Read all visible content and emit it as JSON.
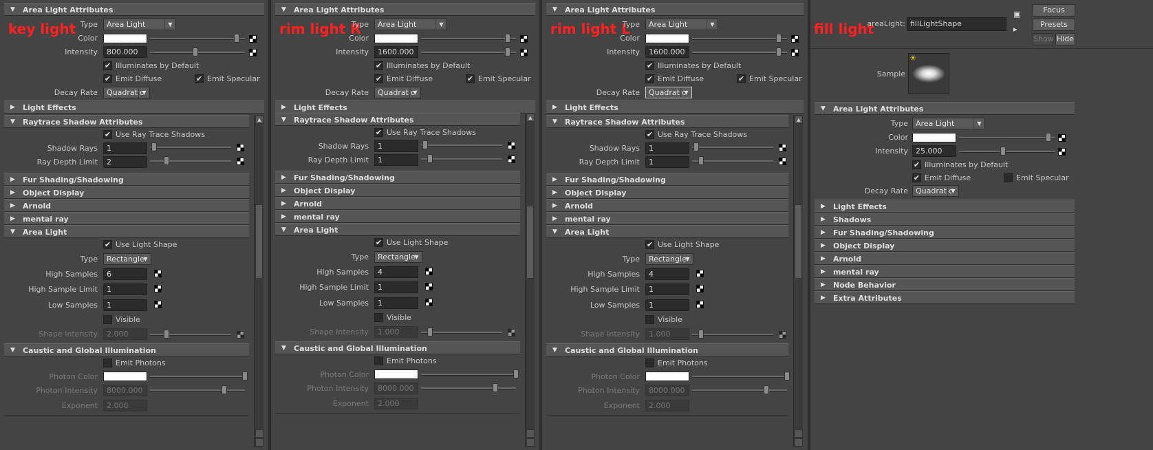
{
  "panes": [
    {
      "label": "key light",
      "type": "Area Light",
      "intensity": "800.000",
      "decay": "Quadratic",
      "shadow_rays": "1",
      "ray_depth": "2",
      "area_type": "Rectangle",
      "high_samples": "6",
      "high_sample_limit": "1",
      "low_samples": "1",
      "shape_intensity": "2.000",
      "photon_intensity": "8000.000",
      "exponent": "2.000"
    },
    {
      "label": "rim light R",
      "type": "Area Light",
      "intensity": "1600.000",
      "decay": "Quadratic",
      "shadow_rays": "1",
      "ray_depth": "1",
      "area_type": "Rectangle",
      "high_samples": "4",
      "high_sample_limit": "1",
      "low_samples": "1",
      "shape_intensity": "1.000",
      "photon_intensity": "8000.000",
      "exponent": "2.000"
    },
    {
      "label": "rim light L",
      "type": "Area Light",
      "intensity": "1600.000",
      "decay": "Quadratic",
      "shadow_rays": "1",
      "ray_depth": "1",
      "area_type": "Rectangle",
      "high_samples": "4",
      "high_sample_limit": "1",
      "low_samples": "1",
      "shape_intensity": "1.000",
      "photon_intensity": "8000.000",
      "exponent": "2.000"
    }
  ],
  "labels": {
    "area_light_attributes": "Area Light Attributes",
    "type": "Type",
    "color": "Color",
    "intensity": "Intensity",
    "illuminates": "Illuminates by Default",
    "emit_diffuse": "Emit Diffuse",
    "emit_specular": "Emit Specular",
    "decay_rate": "Decay Rate",
    "light_effects": "Light Effects",
    "raytrace": "Raytrace Shadow Attributes",
    "use_rt": "Use Ray Trace Shadows",
    "shadow_rays": "Shadow Rays",
    "ray_depth": "Ray Depth Limit",
    "fur": "Fur Shading/Shadowing",
    "object_display": "Object Display",
    "arnold": "Arnold",
    "mental_ray": "mental ray",
    "area_light": "Area Light",
    "use_light_shape": "Use Light Shape",
    "high_samples": "High Samples",
    "high_sample_limit": "High Sample Limit",
    "low_samples": "Low Samples",
    "visible": "Visible",
    "shape_intensity": "Shape Intensity",
    "caustic": "Caustic and Global Illumination",
    "emit_photons": "Emit Photons",
    "photon_color": "Photon Color",
    "photon_intensity": "Photon Intensity",
    "exponent": "Exponent",
    "shadows": "Shadows",
    "node_behavior": "Node Behavior",
    "extra_attributes": "Extra Attributes"
  },
  "fill": {
    "label": "fill light",
    "node_label": "areaLight:",
    "node_name": "fillLightShape",
    "sample_label": "Sample",
    "type": "Area Light",
    "intensity": "25.000",
    "decay": "Quadratic",
    "buttons": {
      "focus": "Focus",
      "presets": "Presets",
      "show": "Show",
      "hide": "Hide"
    },
    "icons": [
      "load-attributes-icon",
      "copy-tab-icon"
    ]
  },
  "colors": {
    "label_red": "#ff2020",
    "panel_bg": "#444444",
    "header_bg": "#555555",
    "field_bg": "#2b2b2b"
  }
}
